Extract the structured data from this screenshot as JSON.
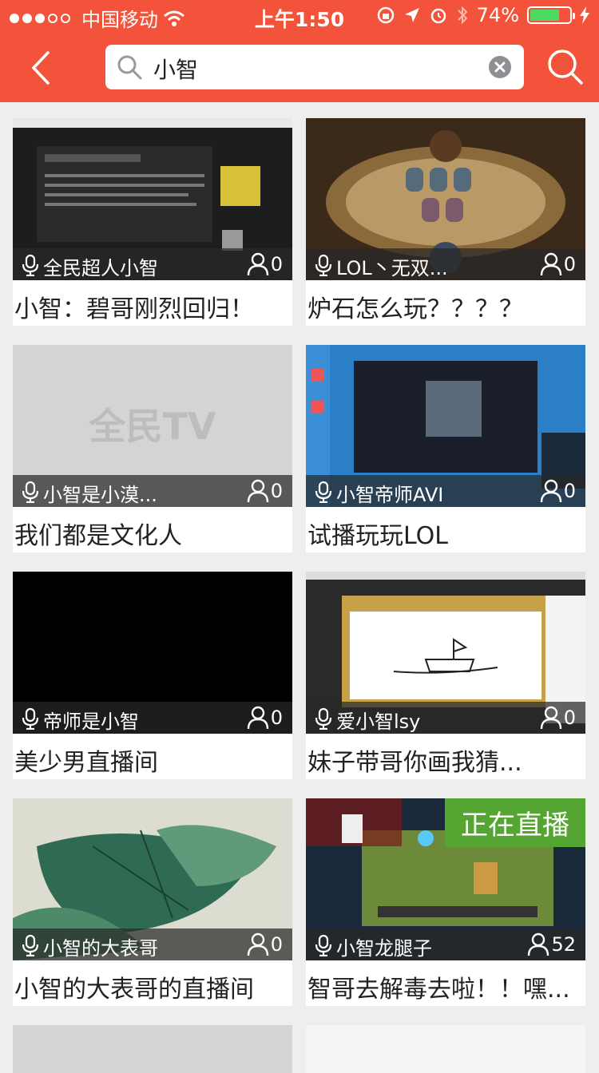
{
  "status_bar": {
    "carrier": "中国移动",
    "time": "上午1:50",
    "battery_percent": "74%",
    "battery_level": 0.74
  },
  "search": {
    "value": "小智"
  },
  "colors": {
    "header": "#f4533b",
    "live_badge": "#55a532"
  },
  "cards": [
    {
      "anchor": "全民超人小智",
      "viewers": "0",
      "title": "小智：碧哥刚烈回归！",
      "live": false,
      "thumb": "stream-screen"
    },
    {
      "anchor": "LOL丶无双...",
      "viewers": "0",
      "title": "炉石怎么玩？？？？",
      "live": false,
      "thumb": "hearthstone-board"
    },
    {
      "anchor": "小智是小漠...",
      "viewers": "0",
      "title": "我们都是文化人",
      "live": false,
      "thumb": "placeholder-logo"
    },
    {
      "anchor": "小智帝师AVI",
      "viewers": "0",
      "title": "试播玩玩LOL",
      "live": false,
      "thumb": "game-client"
    },
    {
      "anchor": "帝师是小智",
      "viewers": "0",
      "title": "美少男直播间",
      "live": false,
      "thumb": "black-screen"
    },
    {
      "anchor": "爱小智lsy",
      "viewers": "0",
      "title": "妹子带哥你画我猜...",
      "live": false,
      "thumb": "drawing-game"
    },
    {
      "anchor": "小智的大表哥",
      "viewers": "0",
      "title": "小智的大表哥的直播间",
      "live": false,
      "thumb": "lotus-painting"
    },
    {
      "anchor": "小智龙腿子",
      "viewers": "52",
      "title": "智哥去解毒去啦！！嘿...",
      "live": true,
      "live_label": "正在直播",
      "thumb": "mmo-game"
    }
  ],
  "placeholder_logo": "全民TV"
}
